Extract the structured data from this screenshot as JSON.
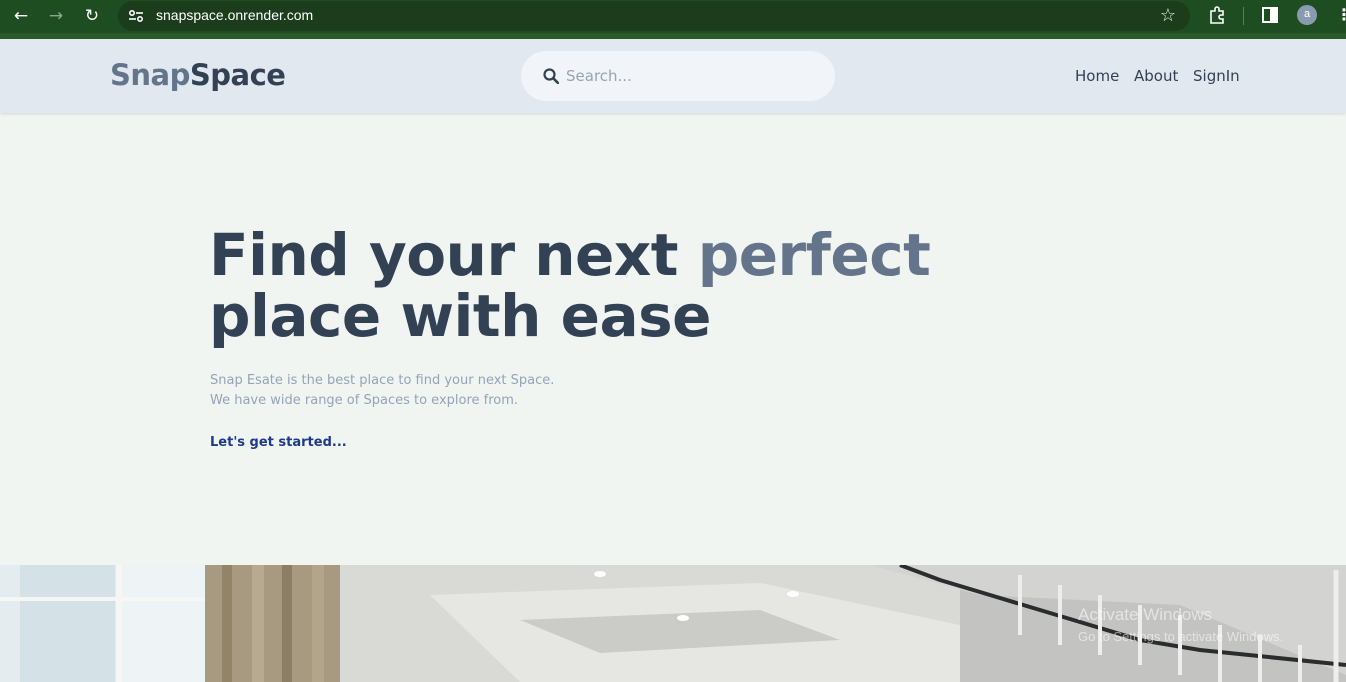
{
  "browser": {
    "url": "snapspace.onrender.com",
    "avatar_letter": "a",
    "accent_color": "#1f4d22"
  },
  "header": {
    "logo_part1": "Snap",
    "logo_part2": "Space",
    "search_placeholder": "Search...",
    "nav": {
      "home": "Home",
      "about": "About",
      "signin": "SignIn"
    }
  },
  "hero": {
    "title_part1": "Find your next ",
    "title_accent": "perfect",
    "title_part2": "place with ease",
    "description_line1": "Snap Esate is the best place to find your next Space.",
    "description_line2": "We have wide range of Spaces to explore from.",
    "cta": "Let's get started..."
  },
  "os_watermark": {
    "line1": "Activate Windows",
    "line2": "Go to Settings to activate Windows."
  },
  "colors": {
    "page_bg": "#f0f5f1",
    "header_bg": "#e2e8f0",
    "text_dark": "#334155",
    "text_accent": "#64748b",
    "cta": "#1e3a8a"
  }
}
